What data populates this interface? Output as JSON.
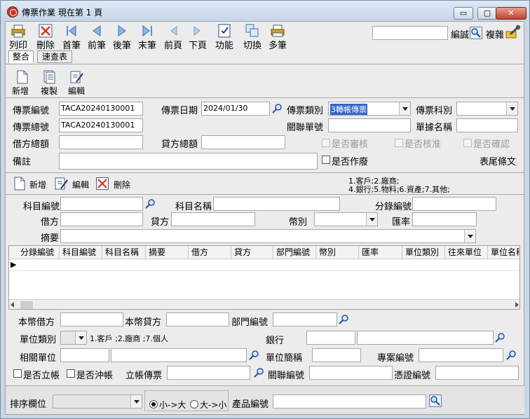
{
  "window": {
    "title": "傳票作業  現在第 1 頁",
    "min_symbol": "▭",
    "max_symbol": "▢",
    "close_symbol": "✕"
  },
  "toolbar": {
    "items": [
      {
        "label": "列印",
        "icon": "printer-icon"
      },
      {
        "label": "刪除",
        "icon": "delete-icon"
      },
      {
        "label": "首筆",
        "icon": "first-record-icon"
      },
      {
        "label": "前筆",
        "icon": "previous-record-icon"
      },
      {
        "label": "後筆",
        "icon": "next-record-icon"
      },
      {
        "label": "末筆",
        "icon": "last-record-icon"
      },
      {
        "label": "前頁",
        "icon": "previous-page-icon"
      },
      {
        "label": "下頁",
        "icon": "next-page-icon"
      },
      {
        "label": "功能",
        "icon": "function-icon"
      },
      {
        "label": "切換",
        "icon": "switch-icon"
      },
      {
        "label": "多筆",
        "icon": "multi-record-icon"
      }
    ],
    "search_value": "",
    "edit_label": "編誠",
    "copy_label": "複雜"
  },
  "tabs": [
    {
      "label": "整合",
      "active": true
    },
    {
      "label": "速查表",
      "active": false
    }
  ],
  "doc_actions": {
    "new": "新增",
    "copy": "複製",
    "edit": "編輯"
  },
  "header": {
    "voucher_no_label": "傳票編號",
    "voucher_no": "TACA20240130001",
    "date_label": "傳票日期",
    "date": "2024/01/30",
    "type_label": "傳票類別",
    "type_value": "3轉帳傳票",
    "subject_label": "傳票科別",
    "subject_value": "",
    "total_no_label": "傳票總號",
    "total_no": "TACA20240130001",
    "related_label": "關聯單號",
    "related_value": "",
    "doc_name_label": "單據名稱",
    "doc_name_value": "",
    "debit_total_label": "借方總額",
    "debit_total": "",
    "credit_total_label": "貸方總額",
    "credit_total": "",
    "reviewed_label": "是否審核",
    "approved_label": "是否核准",
    "confirmed_label": "是否確認",
    "remark_label": "備註",
    "remark": "",
    "void_label": "是否作廢",
    "footer_label": "表尾條文"
  },
  "detail_actions": {
    "new": "新增",
    "edit": "編輯",
    "delete": "刪除",
    "note_line1": "1.客戶;2.廠商;",
    "note_line2": "4.銀行;5.物料;6.資產;7.其他;"
  },
  "detail": {
    "account_code_label": "科目編號",
    "account_code": "",
    "account_name_label": "科目名稱",
    "account_name": "",
    "entry_no_label": "分錄編號",
    "entry_no": "",
    "debit_label": "借方",
    "debit": "",
    "credit_label": "貸方",
    "credit": "",
    "currency_label": "幣別",
    "currency": "",
    "rate_label": "匯率",
    "rate": "",
    "summary_label": "摘要",
    "summary": ""
  },
  "grid": {
    "columns": [
      "分錄編號",
      "科目編號",
      "科目名稱",
      "摘要",
      "借方",
      "貸方",
      "部門編號",
      "幣別",
      "匯率",
      "單位類別",
      "往來單位",
      "單位名稱"
    ],
    "row_marker": "▶"
  },
  "bottom": {
    "local_debit_label": "本幣借方",
    "local_debit": "",
    "local_credit_label": "本幣貸方",
    "local_credit": "",
    "dept_label": "部門編號",
    "dept": "",
    "unit_type_label": "單位類別",
    "unit_type": "",
    "unit_type_note": "1.客戶 ;2.廠商 ;7.個人",
    "bank_label": "銀行",
    "bank_code": "",
    "bank_name": "",
    "related_unit_label": "相關單位",
    "related_unit_code": "",
    "related_unit_name": "",
    "unit_abbr_label": "單位簡稱",
    "unit_abbr": "",
    "project_label": "專案編號",
    "project": "",
    "is_open_label": "是否立帳",
    "is_offset_label": "是否沖帳",
    "open_voucher_label": "立帳傳票",
    "open_voucher": "",
    "related_code_label": "關聯編號",
    "related_code": "",
    "proof_label": "憑證編號",
    "proof": ""
  },
  "footer": {
    "sort_label": "排序欄位",
    "sort_value": "",
    "asc_label": "小->大",
    "desc_label": "大->小",
    "product_label": "產品編號",
    "product_value": ""
  }
}
